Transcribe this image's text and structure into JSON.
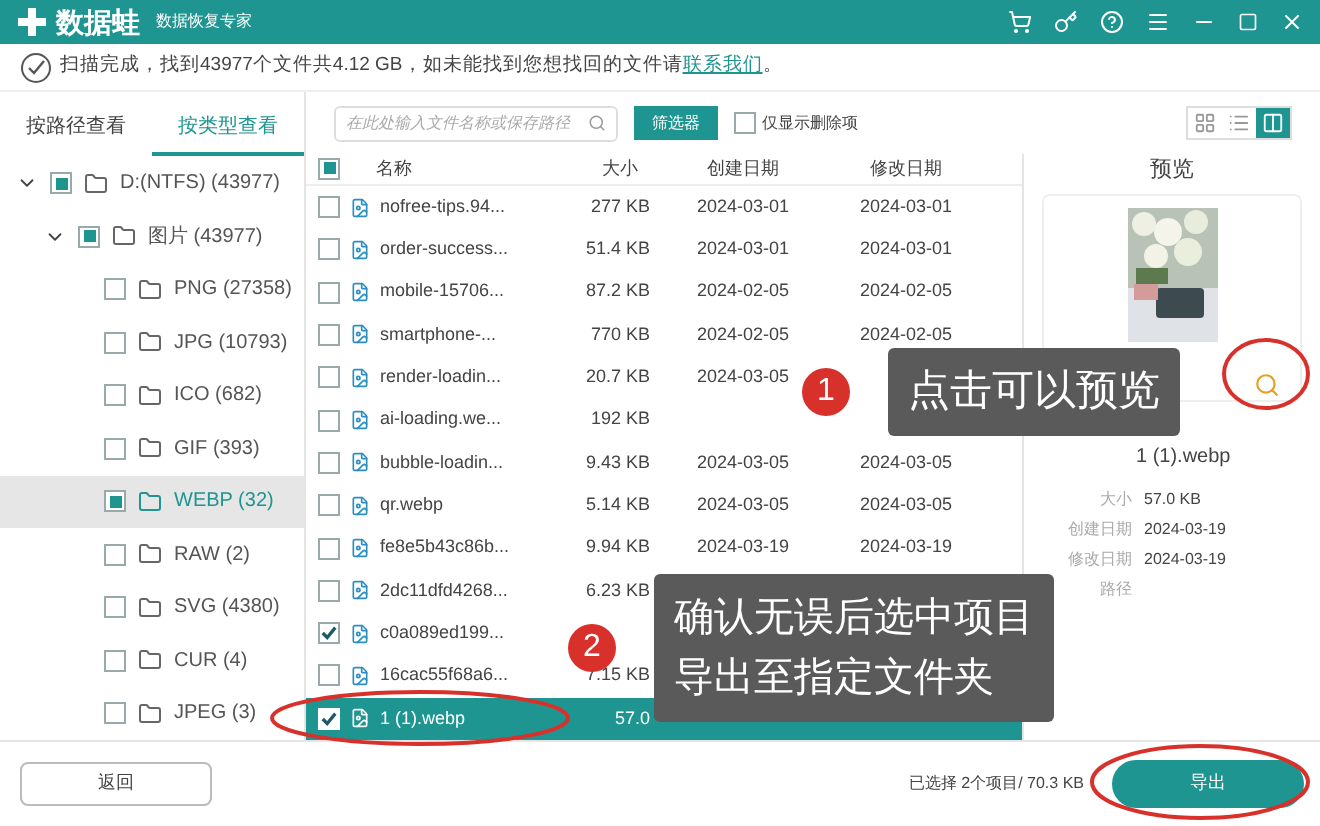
{
  "window": {
    "app_name": "数据蛙",
    "subtitle": "数据恢复专家"
  },
  "status": {
    "text": "扫描完成，找到43977个文件共4.12 GB，如未能找到您想找回的文件请",
    "link": "联系我们",
    "end": "。"
  },
  "tabs": [
    {
      "label": "按路径查看",
      "selected": false
    },
    {
      "label": "按类型查看",
      "selected": true
    }
  ],
  "tree": [
    {
      "label": "D:(NTFS) (43977)",
      "checked": true,
      "expanded": true,
      "selected": false,
      "children": [
        {
          "label": "图片 (43977)",
          "checked": true,
          "expanded": true,
          "selected": false,
          "children": [
            {
              "label": "PNG (27358)",
              "checked": false,
              "selected": false
            },
            {
              "label": "JPG (10793)",
              "checked": false,
              "selected": false
            },
            {
              "label": "ICO (682)",
              "checked": false,
              "selected": false
            },
            {
              "label": "GIF (393)",
              "checked": false,
              "selected": false
            },
            {
              "label": "WEBP (32)",
              "checked": true,
              "selected": true
            },
            {
              "label": "RAW (2)",
              "checked": false,
              "selected": false
            },
            {
              "label": "SVG (4380)",
              "checked": false,
              "selected": false
            },
            {
              "label": "CUR (4)",
              "checked": false,
              "selected": false
            },
            {
              "label": "JPEG (3)",
              "checked": false,
              "selected": false
            }
          ]
        }
      ]
    }
  ],
  "toolbar": {
    "search_placeholder": "在此处输入文件名称或保存路径",
    "filter_button": "筛选器",
    "deleted_only": {
      "label": "仅显示删除项",
      "checked": false
    },
    "views": [
      {
        "kind": "grid",
        "selected": false
      },
      {
        "kind": "list",
        "selected": false
      },
      {
        "kind": "detail",
        "selected": true
      }
    ]
  },
  "table": {
    "header_checked": true,
    "columns": [
      "名称",
      "大小",
      "创建日期",
      "修改日期"
    ],
    "rows": [
      {
        "name": "nofree-tips.94...",
        "size": "277 KB",
        "created": "2024-03-01",
        "modified": "2024-03-01",
        "checked": false,
        "selected": false
      },
      {
        "name": "order-success...",
        "size": "51.4 KB",
        "created": "2024-03-01",
        "modified": "2024-03-01",
        "checked": false,
        "selected": false
      },
      {
        "name": "mobile-15706...",
        "size": "87.2 KB",
        "created": "2024-02-05",
        "modified": "2024-02-05",
        "checked": false,
        "selected": false
      },
      {
        "name": "smartphone-...",
        "size": "770 KB",
        "created": "2024-02-05",
        "modified": "2024-02-05",
        "checked": false,
        "selected": false
      },
      {
        "name": "render-loadin...",
        "size": "20.7 KB",
        "created": "2024-03-05",
        "checked": false,
        "selected": false
      },
      {
        "name": "ai-loading.we...",
        "size": "192 KB",
        "checked": false,
        "selected": false
      },
      {
        "name": "bubble-loadin...",
        "size": "9.43 KB",
        "created": "2024-03-05",
        "modified": "2024-03-05",
        "checked": false,
        "selected": false
      },
      {
        "name": "qr.webp",
        "size": "5.14 KB",
        "created": "2024-03-05",
        "modified": "2024-03-05",
        "checked": false,
        "selected": false
      },
      {
        "name": "fe8e5b43c86b...",
        "size": "9.94 KB",
        "created": "2024-03-19",
        "modified": "2024-03-19",
        "checked": false,
        "selected": false
      },
      {
        "name": "2dc11dfd4268...",
        "size": "6.23 KB",
        "checked": false,
        "selected": false
      },
      {
        "name": "c0a089ed199...",
        "checked": true,
        "selected": false
      },
      {
        "name": "16cac55f68a6...",
        "size": "7.15 KB",
        "checked": false,
        "selected": false
      },
      {
        "name": "1 (1).webp",
        "size": "57.0",
        "checked": true,
        "selected": true
      }
    ]
  },
  "preview": {
    "title": "预览",
    "file_name": "1 (1).webp",
    "details": [
      {
        "label": "大小",
        "value": "57.0 KB"
      },
      {
        "label": "创建日期",
        "value": "2024-03-19"
      },
      {
        "label": "修改日期",
        "value": "2024-03-19"
      },
      {
        "label": "路径"
      }
    ]
  },
  "footer": {
    "back_button": "返回",
    "summary": "已选择 2个项目/ 70.3 KB",
    "export_button": "导出"
  },
  "annotations": [
    {
      "badge": "1",
      "lines": [
        "点击可以预览"
      ]
    },
    {
      "badge": "2",
      "lines": [
        "确认无误后选中项目",
        "导出至指定文件夹"
      ]
    }
  ]
}
